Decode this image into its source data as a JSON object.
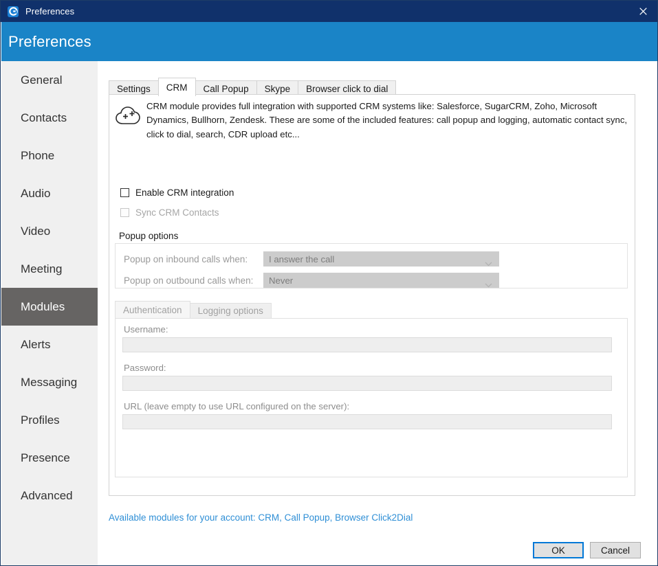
{
  "window": {
    "titlebar_title": "Preferences",
    "app_icon": "app-logo-icon",
    "close_icon": "close-icon",
    "accent_titlebar_color": "#10316b",
    "accent_header_color": "#1a84c7",
    "accent_link_color": "#2f8fd6",
    "focus_border_color": "#0078d7"
  },
  "header": {
    "title": "Preferences"
  },
  "sidebar": {
    "items": [
      {
        "label": "General",
        "selected": false
      },
      {
        "label": "Contacts",
        "selected": false
      },
      {
        "label": "Phone",
        "selected": false
      },
      {
        "label": "Audio",
        "selected": false
      },
      {
        "label": "Video",
        "selected": false
      },
      {
        "label": "Meeting",
        "selected": false
      },
      {
        "label": "Modules",
        "selected": true
      },
      {
        "label": "Alerts",
        "selected": false
      },
      {
        "label": "Messaging",
        "selected": false
      },
      {
        "label": "Profiles",
        "selected": false
      },
      {
        "label": "Presence",
        "selected": false
      },
      {
        "label": "Advanced",
        "selected": false
      }
    ]
  },
  "tabs": [
    {
      "label": "Settings",
      "active": false
    },
    {
      "label": "CRM",
      "active": true
    },
    {
      "label": "Call Popup",
      "active": false
    },
    {
      "label": "Skype",
      "active": false
    },
    {
      "label": "Browser click to dial",
      "active": false
    }
  ],
  "crm": {
    "icon": "cloud-plus-icon",
    "description": "CRM module provides full integration with supported CRM systems like: Salesforce, SugarCRM, Zoho, Microsoft Dynamics, Bullhorn, Zendesk. These are some of the included features: call popup and logging, automatic contact sync, click to dial, search, CDR upload etc...",
    "enable_checkbox": {
      "label": "Enable CRM integration",
      "checked": false,
      "disabled": false
    },
    "sync_checkbox": {
      "label": "Sync CRM Contacts",
      "checked": false,
      "disabled": true
    },
    "popup_options": {
      "group_label": "Popup options",
      "inbound": {
        "label": "Popup on inbound calls when:",
        "value": "I answer the call",
        "disabled": true,
        "chevron": "chevron-down-icon"
      },
      "outbound": {
        "label": "Popup on outbound calls when:",
        "value": "Never",
        "disabled": true,
        "chevron": "chevron-down-icon"
      }
    },
    "inner_tabs": [
      {
        "label": "Authentication",
        "active": true
      },
      {
        "label": "Logging options",
        "active": false
      }
    ],
    "authentication": {
      "username_label": "Username:",
      "username_value": "",
      "password_label": "Password:",
      "password_value": "",
      "url_label": "URL (leave empty to use URL configured on the server):",
      "url_value": ""
    }
  },
  "footer": {
    "available_modules_link": "Available modules for your account: CRM, Call Popup, Browser Click2Dial",
    "ok_label": "OK",
    "cancel_label": "Cancel"
  }
}
